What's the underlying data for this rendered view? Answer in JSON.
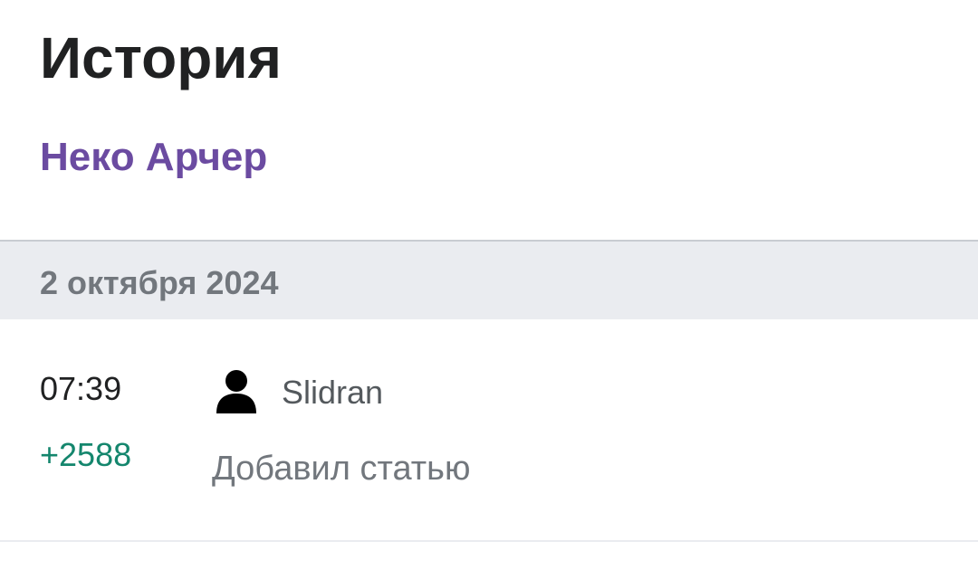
{
  "header": {
    "title": "История",
    "article_link": "Неко Арчер"
  },
  "history": {
    "groups": [
      {
        "date": "2 октября 2024",
        "entries": [
          {
            "time": "07:39",
            "diff": "+2588",
            "user": "Slidran",
            "user_icon": "user-avatar-icon",
            "summary": "Добавил статью"
          }
        ]
      }
    ]
  },
  "colors": {
    "title": "#202122",
    "link": "#6b4ba1",
    "date_bg": "#eaecf0",
    "date_text": "#72777d",
    "diff_positive": "#14866d",
    "user_text": "#54595d",
    "summary_text": "#72777d"
  }
}
